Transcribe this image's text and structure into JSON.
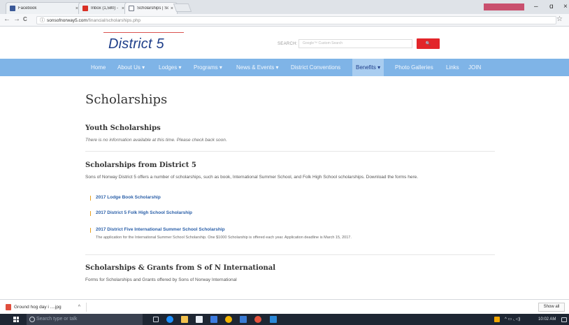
{
  "browser": {
    "tabs": [
      {
        "title": "Facebook",
        "close": "×",
        "favicon_color": "#3b5998"
      },
      {
        "title": "Inbox (1,580) - amason...",
        "close": "×",
        "favicon_color": "#d93025"
      },
      {
        "title": "Scholarships | Sons of N...",
        "close": "×",
        "favicon_color": "#6b7280"
      }
    ],
    "profile_badge": "",
    "window_controls": {
      "minimize": "–",
      "maximize": "ɑ",
      "close": "×"
    },
    "nav": {
      "back": "←",
      "forward": "→",
      "reload": "C"
    },
    "url": {
      "host": "sonsofnorway5.com",
      "path": "/financial/scholarships.php"
    },
    "star": "☆"
  },
  "site": {
    "logo": "District 5",
    "search_label": "SEARCH:",
    "search_placeholder": "Google™ Custom Search",
    "search_button": "🔍"
  },
  "nav": [
    {
      "label": "Home",
      "active": false
    },
    {
      "label": "About Us ▾",
      "active": false
    },
    {
      "label": "Lodges ▾",
      "active": false
    },
    {
      "label": "Programs ▾",
      "active": false
    },
    {
      "label": "News & Events ▾",
      "active": false
    },
    {
      "label": "District Conventions",
      "active": false
    },
    {
      "label": "Benefits ▾",
      "active": true
    },
    {
      "label": "Photo Galleries",
      "active": false
    },
    {
      "label": "Links",
      "active": false
    },
    {
      "label": "JOIN",
      "active": false
    }
  ],
  "page": {
    "title": "Scholarships",
    "youth": {
      "title": "Youth Scholarships",
      "text": "There is no information available at this time. Please check back soon."
    },
    "district": {
      "title": "Scholarships from District 5",
      "text": "Sons of Norway District 5 offers a number of scholarships, such as book, International Summer School, and Folk High School scholarships. Download the forms here.",
      "links": [
        {
          "label": "2017 Lodge Book Scholarship"
        },
        {
          "label": "2017 District 5 Folk High School Scholarship"
        },
        {
          "label": "2017 District Five International Summer School Scholarship",
          "desc": "The application for the International Summer School Scholarship. One $1000 Scholarship is offered each year. Application deadline is March 15, 2017."
        }
      ]
    },
    "international": {
      "title": "Scholarships & Grants from S of N International",
      "text": "Forms for Scholarships and Grants offered by Sons of Norway International"
    }
  },
  "downloads": {
    "item": "Ground hog day i ....jpg",
    "caret": "^",
    "show_all": "Show all"
  },
  "taskbar": {
    "search_placeholder": "Search type or talk",
    "time": "10:02 AM"
  }
}
